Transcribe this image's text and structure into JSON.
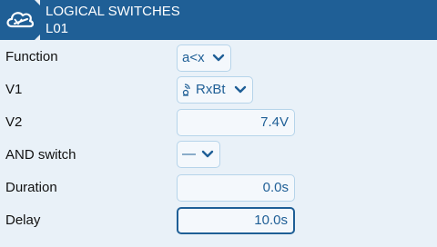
{
  "header": {
    "title": "LOGICAL SWITCHES",
    "subtitle": "L01",
    "logo_icon": "cloud-logo-icon",
    "color": "#1f5f96"
  },
  "rows": {
    "function": {
      "label": "Function",
      "value": "a<x",
      "control": "dropdown"
    },
    "v1": {
      "label": "V1",
      "value": "RxBt",
      "icon": "telemetry-icon",
      "control": "dropdown"
    },
    "v2": {
      "label": "V2",
      "value": "7.4V",
      "control": "number"
    },
    "and_switch": {
      "label": "AND switch",
      "value": "—",
      "control": "dropdown"
    },
    "duration": {
      "label": "Duration",
      "value": "0.0s",
      "control": "number"
    },
    "delay": {
      "label": "Delay",
      "value": "10.0s",
      "control": "number",
      "focused": true
    }
  },
  "colors": {
    "background": "#e9f1f8",
    "accent": "#1f5f96",
    "field_border": "#b6d4ea"
  }
}
